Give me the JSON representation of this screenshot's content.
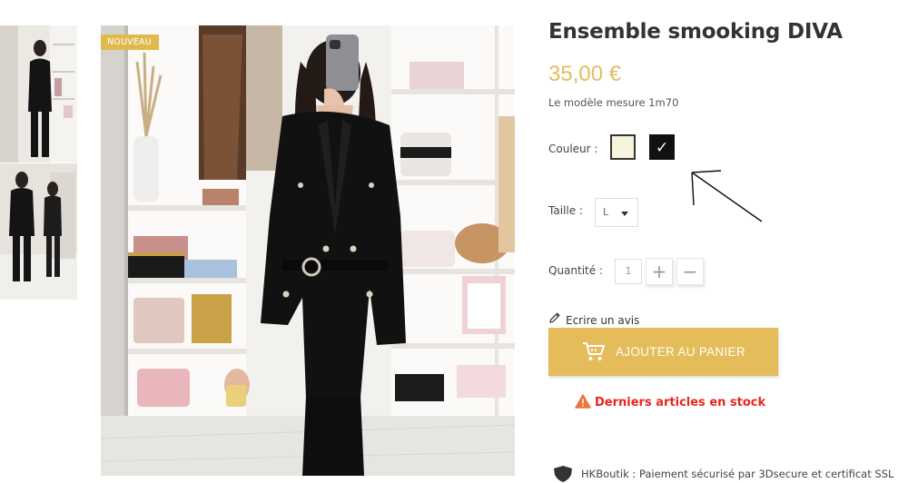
{
  "product": {
    "badge": "NOUVEAU",
    "title": "Ensemble smooking DIVA",
    "price": "35,00 €",
    "model_info": "Le modèle mesure 1m70"
  },
  "options": {
    "color_label": "Couleur :",
    "colors": [
      {
        "name": "cream",
        "hex": "#f6f4dc",
        "selected": false
      },
      {
        "name": "black",
        "hex": "#111111",
        "selected": true
      }
    ],
    "size_label": "Taille :",
    "size_value": "L",
    "qty_label": "Quantité :",
    "qty_value": "1",
    "qty_plus": "+",
    "qty_minus": "−"
  },
  "actions": {
    "review_link": "Ecrire un avis",
    "add_to_cart": "AJOUTER AU PANIER"
  },
  "stock_warning": "Derniers articles en stock",
  "secure_note": "HKBoutik : Paiement sécurisé par 3Dsecure et certificat SSL",
  "colors": {
    "accent": "#e4bc59",
    "price": "#e3bd5d",
    "warning": "#e8251e",
    "text": "#333333"
  }
}
